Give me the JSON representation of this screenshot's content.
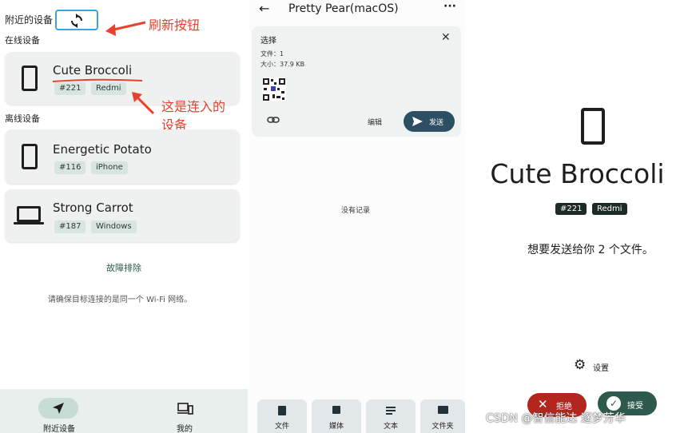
{
  "panel1": {
    "header_title": "附近的设备",
    "online_label": "在线设备",
    "offline_label": "离线设备",
    "online_devices": [
      {
        "name": "Cute Broccoli",
        "id": "#221",
        "platform": "Redmi",
        "icon": "phone-icon"
      }
    ],
    "offline_devices": [
      {
        "name": "Energetic Potato",
        "id": "#116",
        "platform": "iPhone",
        "icon": "phone-icon"
      },
      {
        "name": "Strong Carrot",
        "id": "#187",
        "platform": "Windows",
        "icon": "laptop-icon"
      }
    ],
    "troubleshoot": "故障排除",
    "wifi_hint": "请确保目标连接的是同一个 Wi-Fi 网络。",
    "annotation_refresh": "刷新按钮",
    "annotation_connected_line1": "这是连入的",
    "annotation_connected_line2": "设备",
    "nav": [
      {
        "label": "附近设备",
        "icon": "send-icon",
        "active": true
      },
      {
        "label": "我的",
        "icon": "devices-icon",
        "active": false
      }
    ]
  },
  "panel2": {
    "title": "Pretty Pear(macOS)",
    "menu_glyph": "···",
    "back_glyph": "←",
    "select_title": "选择",
    "file_count": "文件：1",
    "size": "大小：37.9 KB",
    "edit_label": "编辑",
    "send_label": "发送",
    "empty_text": "没有记录",
    "tabs": [
      {
        "label": "文件",
        "icon": "file-icon"
      },
      {
        "label": "媒体",
        "icon": "image-icon"
      },
      {
        "label": "文本",
        "icon": "text-icon"
      },
      {
        "label": "文件夹",
        "icon": "folder-icon"
      }
    ]
  },
  "panel3": {
    "device_name": "Cute Broccoli",
    "id": "#221",
    "platform": "Redmi",
    "message": "想要发送给你 2 个文件。",
    "settings_label": "设置",
    "reject_label": "拒绝",
    "accept_label": "接受",
    "reject_color": "#b3261e",
    "accept_color": "#2d5a4c"
  },
  "watermark": "CSDN @智信能达 逐梦芳华",
  "colors": {
    "annotation": "#e8412e",
    "card_bg": "#eef1ef",
    "chip_bg": "#d8e4df"
  }
}
